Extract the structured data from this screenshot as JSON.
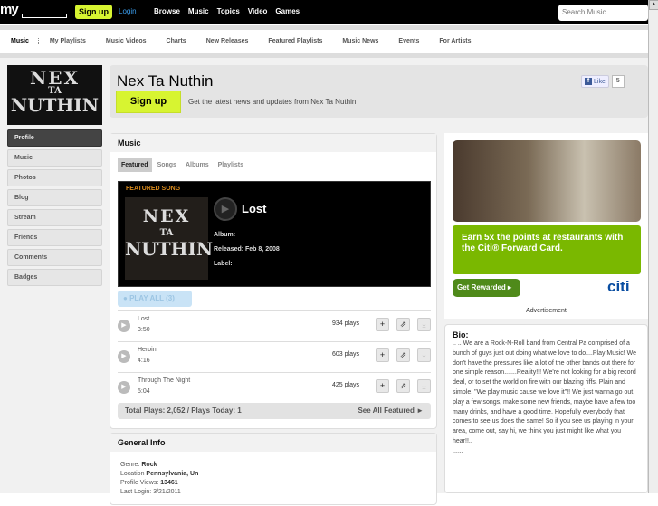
{
  "topbar": {
    "logo": "my",
    "signup": "Sign up",
    "login": "Login",
    "nav": [
      "Browse",
      "Music",
      "Topics",
      "Video",
      "Games"
    ],
    "search_placeholder": "Search Music"
  },
  "subnav": [
    "Music",
    "My Playlists",
    "Music Videos",
    "Charts",
    "New Releases",
    "Featured Playlists",
    "Music News",
    "Events",
    "For Artists"
  ],
  "artist": {
    "logo_text": [
      "NEX",
      "TA",
      "NUTHIN"
    ],
    "name": "Nex Ta Nuthin",
    "signup": "Sign up",
    "tagline": "Get the latest news and updates from Nex Ta Nuthin",
    "like_label": "Like",
    "like_count": "5"
  },
  "sidebar": [
    "Profile",
    "Music",
    "Photos",
    "Blog",
    "Stream",
    "Friends",
    "Comments",
    "Badges"
  ],
  "music": {
    "title": "Music",
    "tabs": [
      "Featured",
      "Songs",
      "Albums",
      "Playlists"
    ],
    "featured": {
      "label": "FEATURED SONG",
      "song": "Lost",
      "album": "Album:",
      "released": "Released: Feb 8, 2008",
      "label_field": "Label:"
    },
    "play_all": "PLAY ALL (3)",
    "songs": [
      {
        "name": "Lost",
        "duration": "3:50",
        "plays": "934 plays"
      },
      {
        "name": "Heroin",
        "duration": "4:16",
        "plays": "603 plays"
      },
      {
        "name": "Through The Night",
        "duration": "5:04",
        "plays": "425 plays"
      }
    ],
    "totals": "Total Plays: 2,052 / Plays Today: 1",
    "see_all": "See All Featured ►"
  },
  "general": {
    "title": "General Info",
    "genre_label": "Genre:",
    "genre": "Rock",
    "location_label": "Location",
    "location": "Pennsylvania, Un",
    "views_label": "Profile Views:",
    "views": "13461",
    "last_login": "Last Login: 3/21/2011"
  },
  "ad": {
    "headline": "Earn 5x the points at restaurants with the Citi® Forward Card.",
    "button": "Get Rewarded ▸",
    "brand": "citi",
    "caption": "Advertisement"
  },
  "bio": {
    "title": "Bio:",
    "text": ".. .. We are a Rock-N-Roll band from Central Pa comprised of a bunch of guys just out doing what we love to do....Play Music! We don't have the pressures like a lot of the other bands out there for one simple reason.......Reality!!! We're not looking for a big record deal, or to set the world on fire with our blazing riffs. Plain and simple. \"We play music cause we love it\"!! We just wanna go out, play a few songs, make some new friends, maybe have a few too many drinks, and have a good time. Hopefully everybody that comes to see us does the same! So if you see us playing in your area, come out, say hi, we think you just might like what you hear!!..",
    "more": "......"
  }
}
